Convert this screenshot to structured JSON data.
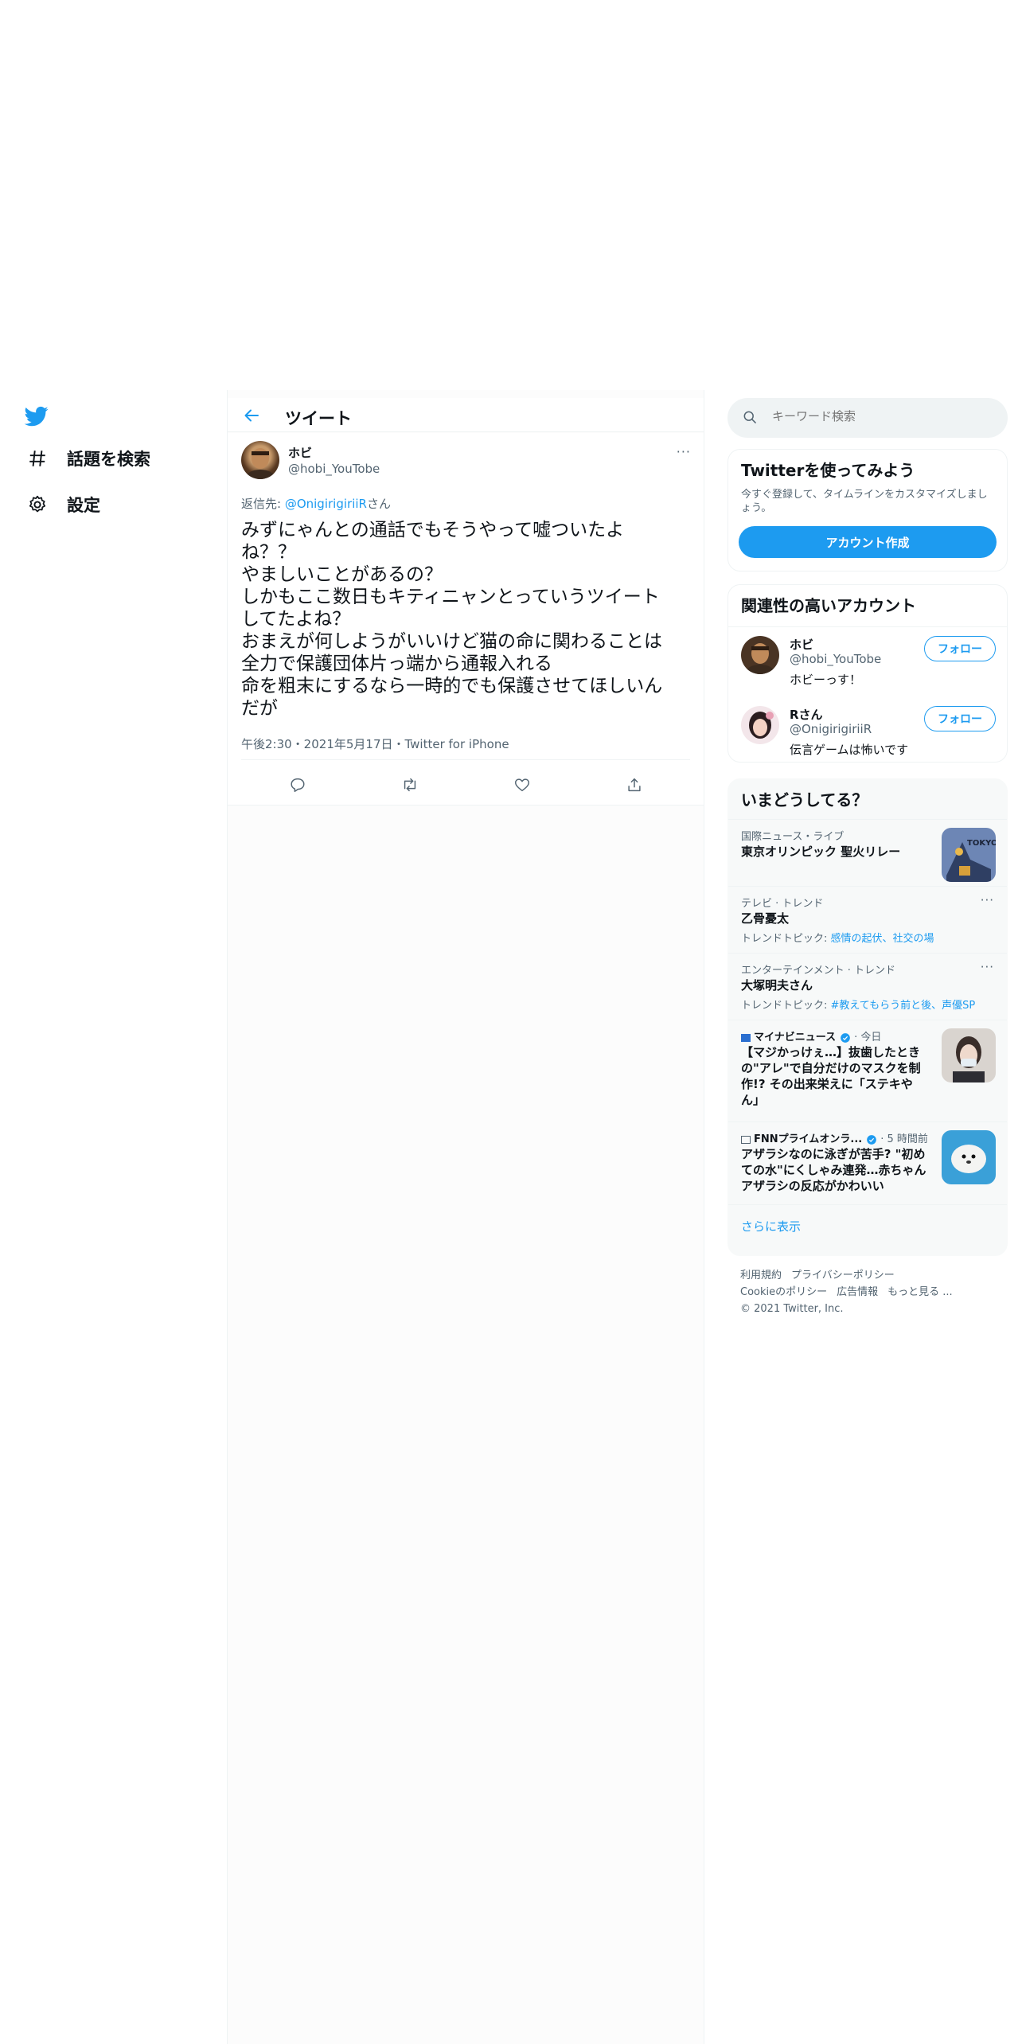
{
  "nav": {
    "logo_icon": "twitter-bird-icon",
    "items": [
      {
        "label": "話題を検索",
        "icon": "hashtag-icon"
      },
      {
        "label": "設定",
        "icon": "gear-icon"
      }
    ]
  },
  "header": {
    "title": "ツイート",
    "back_icon": "arrow-left-icon"
  },
  "tweet": {
    "author_name": "ホビ",
    "author_handle": "@hobi_YouTobe",
    "reply_prefix": "返信先: ",
    "reply_mention": "@OnigirigiriiR",
    "reply_suffix": "さん",
    "lines": [
      "みずにゃんとの通話でもそうやって嘘ついたよ",
      "ね？？",
      "やましいことがあるの？",
      "しかもここ数日もキティニャンとっていうツイート",
      "してたよね？",
      "おまえが何しようがいいけど猫の命に関わることは",
      "全力で保護団体片っ端から通報入れる",
      "命を粗末にするなら一時的でも保護させてほしいん",
      "だが"
    ],
    "timestamp": "午後2:30・2021年5月17日・Twitter for iPhone",
    "more": "···"
  },
  "search": {
    "placeholder": "キーワード検索"
  },
  "signup": {
    "title": "Twitterを使ってみよう",
    "desc": "今すぐ登録して、タイムラインをカスタマイズしましょう。",
    "button": "アカウント作成"
  },
  "who": {
    "title": "関連性の高いアカウント",
    "accounts": [
      {
        "name": "ホビ",
        "handle": "@hobi_YouTobe",
        "bio": "ホビーっす！",
        "button": "フォロー"
      },
      {
        "name": "Rさん",
        "handle": "@OnigirigiriiR",
        "bio": "伝言ゲームは怖いです",
        "button": "フォロー"
      }
    ]
  },
  "trends": {
    "title": "いまどうしてる？",
    "items": [
      {
        "context": "国際ニュース・ライブ",
        "title": "東京オリンピック 聖火リレー",
        "thumb_text": "TOKYO"
      },
      {
        "context": "テレビ · トレンド",
        "title": "乙骨憂太",
        "sub_prefix": "トレンドトピック: ",
        "sub_link": "感情の起伏、社交の場",
        "more": "···"
      },
      {
        "context": "エンターテインメント · トレンド",
        "title": "大塚明夫さん",
        "sub_prefix": "トレンドトピック: ",
        "sub_link": "#教えてもらう前と後、声優SP",
        "more": "···"
      },
      {
        "source": "マイナビニュース",
        "time": "· 今日",
        "title_lines": [
          "【マジかっけぇ…】抜歯したとき",
          "の\"アレ\"で自分だけのマスクを制",
          "作!? その出来栄えに「ステキや",
          "ん」"
        ]
      },
      {
        "source": "FNNプライムオンラ...",
        "time": "· 5 時間前",
        "title_lines": [
          "アザラシなのに泳ぎが苦手? \"初め",
          "ての水\"にくしゃみ連発…赤ちゃん",
          "アザラシの反応がかわいい"
        ]
      }
    ],
    "show_more": "さらに表示"
  },
  "footer": {
    "links_row1": [
      "利用規約",
      "プライバシーポリシー"
    ],
    "links_row2": [
      "Cookieのポリシー",
      "広告情報",
      "もっと見る ..."
    ],
    "copyright": "© 2021 Twitter, Inc."
  },
  "colors": {
    "accent": "#1d9bf0",
    "text": "#0f1419",
    "muted": "#536471"
  }
}
